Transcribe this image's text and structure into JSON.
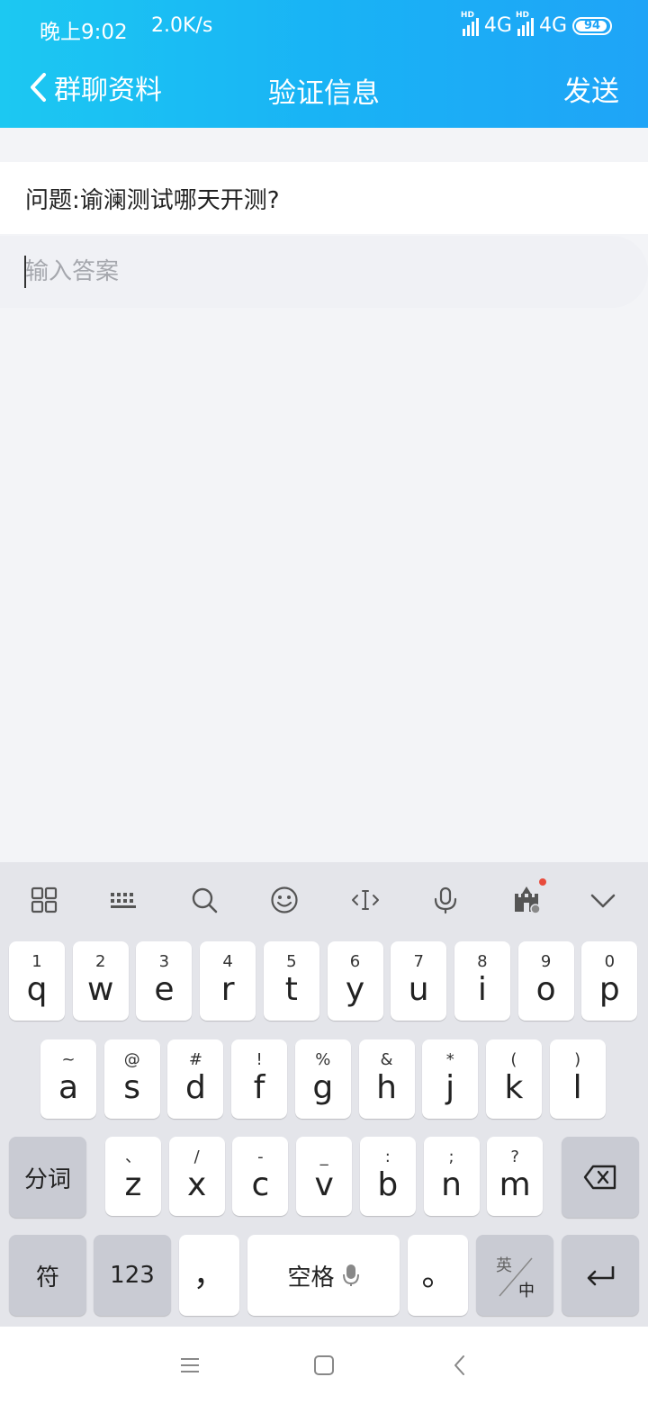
{
  "status": {
    "time": "晚上9:02",
    "speed": "2.0K/s",
    "network1": "4G",
    "network2": "4G",
    "battery": "94"
  },
  "nav": {
    "back_label": "群聊资料",
    "title": "验证信息",
    "send_label": "发送"
  },
  "form": {
    "question": "问题:谕澜测试哪天开测?",
    "answer_placeholder": "输入答案",
    "answer_value": ""
  },
  "keyboard": {
    "toolbar": [
      "grid-icon",
      "keyboard-icon",
      "search-icon",
      "emoji-icon",
      "cursor-move-icon",
      "microphone-icon",
      "castle-icon",
      "collapse-icon"
    ],
    "row1": [
      {
        "main": "q",
        "sub": "1"
      },
      {
        "main": "w",
        "sub": "2"
      },
      {
        "main": "e",
        "sub": "3"
      },
      {
        "main": "r",
        "sub": "4"
      },
      {
        "main": "t",
        "sub": "5"
      },
      {
        "main": "y",
        "sub": "6"
      },
      {
        "main": "u",
        "sub": "7"
      },
      {
        "main": "i",
        "sub": "8"
      },
      {
        "main": "o",
        "sub": "9"
      },
      {
        "main": "p",
        "sub": "0"
      }
    ],
    "row2": [
      {
        "main": "a",
        "sub": "~"
      },
      {
        "main": "s",
        "sub": "@"
      },
      {
        "main": "d",
        "sub": "#"
      },
      {
        "main": "f",
        "sub": "!"
      },
      {
        "main": "g",
        "sub": "%"
      },
      {
        "main": "h",
        "sub": "&"
      },
      {
        "main": "j",
        "sub": "*"
      },
      {
        "main": "k",
        "sub": "("
      },
      {
        "main": "l",
        "sub": ")"
      }
    ],
    "row3": [
      {
        "main": "z",
        "sub": "、"
      },
      {
        "main": "x",
        "sub": "/"
      },
      {
        "main": "c",
        "sub": "-"
      },
      {
        "main": "v",
        "sub": "_"
      },
      {
        "main": "b",
        "sub": ":"
      },
      {
        "main": "n",
        "sub": ";"
      },
      {
        "main": "m",
        "sub": "?"
      }
    ],
    "segment_label": "分词",
    "symbol_label": "符",
    "num_label": "123",
    "comma_label": "，",
    "space_label": "空格",
    "period_label": "。",
    "lang_en": "英",
    "lang_zh": "中"
  }
}
